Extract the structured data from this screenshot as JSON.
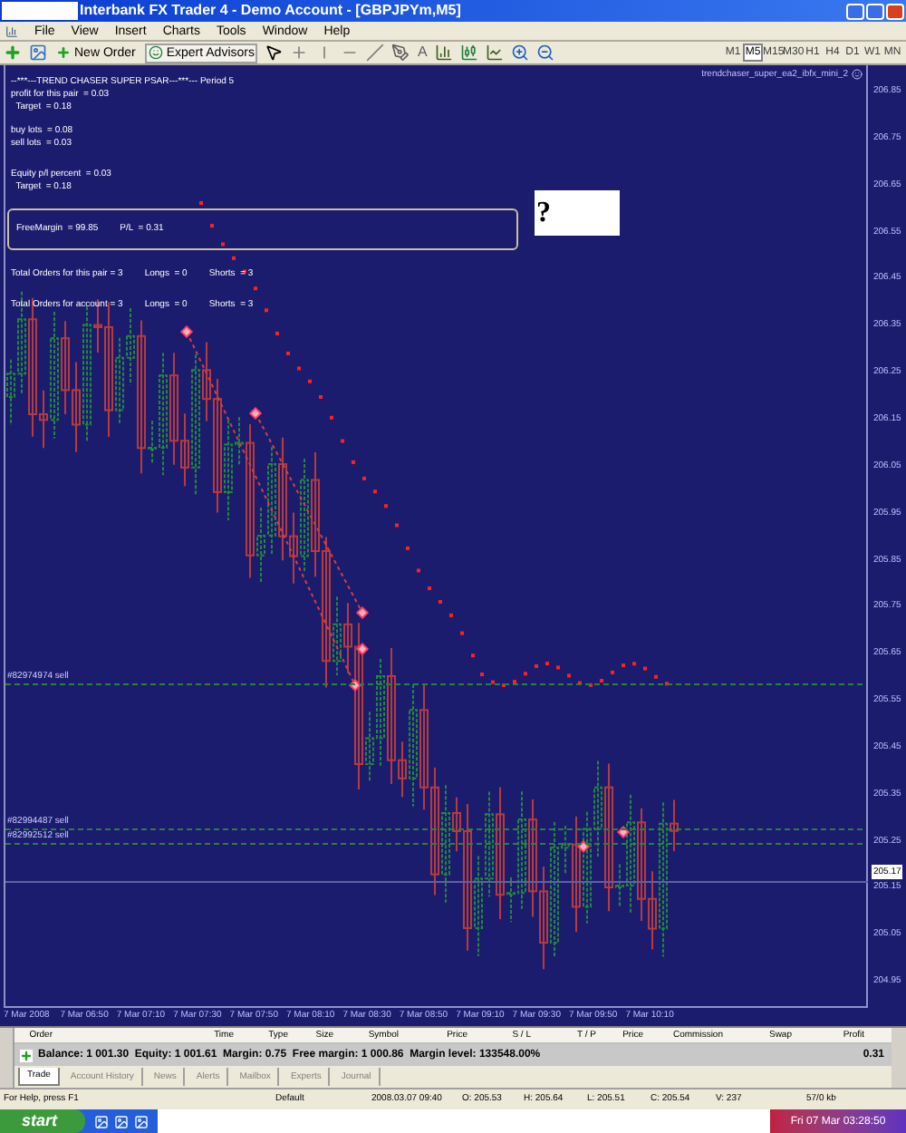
{
  "window": {
    "title": "Interbank FX Trader 4 - Demo Account - [GBPJPYm,M5]"
  },
  "menu": [
    "File",
    "View",
    "Insert",
    "Charts",
    "Tools",
    "Window",
    "Help"
  ],
  "toolbar": {
    "buttons": [
      "New Order",
      "Expert Advisors"
    ],
    "text_tool": "A",
    "timeframes": [
      {
        "label": "M1",
        "selected": false
      },
      {
        "label": "M5",
        "selected": true
      },
      {
        "label": "M15",
        "selected": false
      },
      {
        "label": "M30",
        "selected": false
      },
      {
        "label": "H1",
        "selected": false
      },
      {
        "label": "H4",
        "selected": false
      },
      {
        "label": "D1",
        "selected": false
      },
      {
        "label": "W1",
        "selected": false
      },
      {
        "label": "MN",
        "selected": false
      }
    ]
  },
  "chart": {
    "indicator_label": "trendchaser_super_ea2_ibfx_mini_2",
    "info_groups": [
      {
        "boxed": false,
        "lines": [
          [
            "--***---TREND CHASER SUPER PSAR---***--- Period 5"
          ],
          [
            "profit for this pair  = 0.03"
          ],
          [
            "  Target  = 0.18"
          ]
        ]
      },
      {
        "boxed": false,
        "lines": [
          [
            "buy lots  = 0.08"
          ],
          [
            "sell lots  = 0.03"
          ]
        ]
      },
      {
        "boxed": false,
        "lines": [
          [
            "Equity p/l percent  = 0.03"
          ],
          [
            "  Target  = 0.18"
          ]
        ]
      },
      {
        "boxed": true,
        "lines": [
          [
            "FreeMargin  = 99.85",
            "P/L  = 0.31"
          ]
        ]
      },
      {
        "boxed": false,
        "lines": [
          [
            "Total Orders for this pair = 3",
            "Longs  = 0",
            "Shorts  = 3"
          ]
        ]
      },
      {
        "boxed": false,
        "lines": [
          [
            "Total Orders for account = 3",
            "Longs  = 0",
            "Shorts  = 3"
          ]
        ]
      }
    ],
    "question_box": "?",
    "order_lines": [
      {
        "label": "#82974974 sell"
      },
      {
        "label": "#82994487 sell"
      },
      {
        "label": "#82992512 sell"
      }
    ],
    "current_price": "205.17",
    "price_axis": [
      "206.85",
      "206.75",
      "206.65",
      "206.55",
      "206.45",
      "206.35",
      "206.25",
      "206.15",
      "206.05",
      "205.95",
      "205.85",
      "205.75",
      "205.65",
      "205.55",
      "205.45",
      "205.35",
      "205.25",
      "205.15",
      "205.05",
      "204.95"
    ],
    "time_axis": [
      "7 Mar 2008",
      "7 Mar 06:50",
      "7 Mar 07:10",
      "7 Mar 07:30",
      "7 Mar 07:50",
      "7 Mar 08:10",
      "7 Mar 08:30",
      "7 Mar 08:50",
      "7 Mar 09:10",
      "7 Mar 09:30",
      "7 Mar 09:50",
      "7 Mar 10:10"
    ]
  },
  "terminal": {
    "columns": [
      "Order",
      "Time",
      "Type",
      "Size",
      "Symbol",
      "Price",
      "S / L",
      "T / P",
      "Price",
      "Commission",
      "Swap",
      "Profit"
    ],
    "summary": "Balance: 1 001.30  Equity: 1 001.61  Margin: 0.75  Free margin: 1 000.86  Margin level: 133548.00%",
    "profit": "0.31",
    "tabs": [
      {
        "label": "Trade",
        "selected": true
      },
      {
        "label": "Account History",
        "selected": false
      },
      {
        "label": "News",
        "selected": false
      },
      {
        "label": "Alerts",
        "selected": false
      },
      {
        "label": "Mailbox",
        "selected": false
      },
      {
        "label": "Experts",
        "selected": false
      },
      {
        "label": "Journal",
        "selected": false
      }
    ]
  },
  "status_bar": [
    "For Help, press F1",
    "Default",
    "2008.03.07 09:40",
    "O: 205.53",
    "H: 205.64",
    "L: 205.51",
    "C: 205.54",
    "V: 237",
    "57/0 kb"
  ],
  "taskbar": {
    "start": "start",
    "clock": "Fri 07 Mar 03:28:50"
  }
}
